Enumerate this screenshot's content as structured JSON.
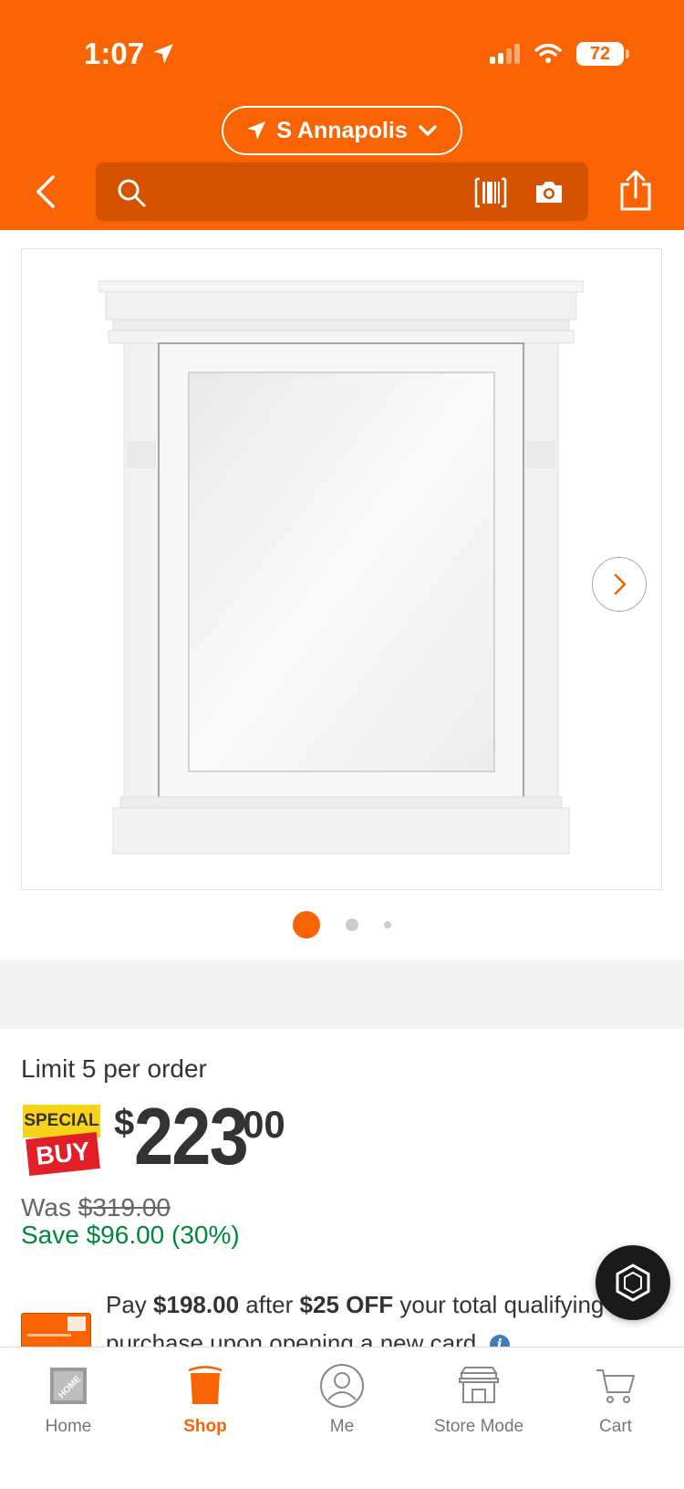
{
  "status_bar": {
    "time": "1:07",
    "battery": "72"
  },
  "header": {
    "location": "S Annapolis"
  },
  "product": {
    "image_count": 3,
    "active_image_index": 0,
    "limit_text": "Limit 5 per order",
    "special_buy_top": "SPECIAL",
    "special_buy_bottom": "BUY",
    "price_currency": "$",
    "price_dollars": "223",
    "price_cents": "00",
    "was_label": "Was",
    "was_price": "$319.00",
    "save_text": "Save $96.00 (30%)",
    "promo": {
      "pay": "Pay",
      "amount": "$198.00",
      "after": "after",
      "discount": "$25 OFF",
      "rest": "your total qualifying purchase upon opening a new card."
    }
  },
  "colors": {
    "brand": "#f96302",
    "save_green": "#00873c",
    "info_blue": "#3e7bbf"
  },
  "bottom_nav": {
    "items": [
      {
        "label": "Home",
        "icon": "home-depot-logo-icon"
      },
      {
        "label": "Shop",
        "icon": "bucket-icon",
        "active": true
      },
      {
        "label": "Me",
        "icon": "user-icon"
      },
      {
        "label": "Store Mode",
        "icon": "store-icon"
      },
      {
        "label": "Cart",
        "icon": "cart-icon"
      }
    ]
  }
}
